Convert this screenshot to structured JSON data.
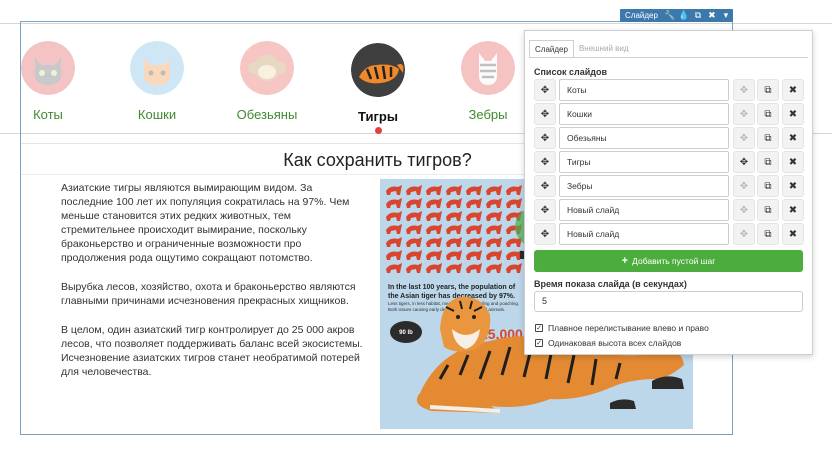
{
  "toolbar": {
    "label": "Слайдер",
    "icons": [
      "wrench-icon",
      "drop-icon",
      "copy-icon",
      "close-icon",
      "chevron-down-icon"
    ],
    "glyphs": [
      "🔧",
      "💧",
      "⧉",
      "✖",
      "▾"
    ]
  },
  "slider_tabs": [
    {
      "label": "Коты",
      "icon": "cat-icon",
      "active": false
    },
    {
      "label": "Кошки",
      "icon": "kitten-icon",
      "active": false
    },
    {
      "label": "Обезьяны",
      "icon": "monkey-icon",
      "active": false
    },
    {
      "label": "Тигры",
      "icon": "tiger-icon",
      "active": true
    },
    {
      "label": "Зебры",
      "icon": "zebra-icon",
      "active": false
    }
  ],
  "content": {
    "title": "Как сохранить тигров?",
    "paragraphs": [
      "Азиатские тигры являются вымирающим видом. За последние 100 лет их популяция сократилась на 97%. Чем меньше становится этих редких животных, тем стремительнее происходит вымирание, поскольку браконьерство и ограниченные возможности про продолжения рода ощутимо сокращают потомство.",
      "Вырубка лесов, хозяйство, охота и браконьерство являются главными причинами исчезновения прекрасных хищников.",
      "В целом, один азиатский тигр контролирует до 25 000 акров лесов, что позволяет поддерживать баланс всей экосистемы. Исчезновение азиатских тигров станет необратимой потерей для человечества."
    ],
    "infographic": {
      "headline": "In the last 100 years, the population of the Asian tiger has decreased by 97%.",
      "subtext": "Less tigers, in less habitat, means more inbreeding and poaching. Both issues causing early death to these beautiful animals.",
      "big_number": "25,000 a",
      "badge": "90 lb",
      "colors": {
        "background": "#bcd6ea",
        "tiger_icon": "#d9452e",
        "dark": "#2b2b2b",
        "green": "#4caf50"
      }
    }
  },
  "panel": {
    "tabs": [
      {
        "label": "Слайдер",
        "active": true
      },
      {
        "label": "Внешний вид",
        "active": false
      }
    ],
    "list_title": "Список слайдов",
    "slides": [
      "Коты",
      "Кошки",
      "Обезьяны",
      "Тигры",
      "Зебры",
      "Новый слайд",
      "Новый слайд"
    ],
    "add_button_label": "Добавить пустой шаг",
    "add_button_glyph": "+",
    "time_label": "Время показа слайда (в секундах)",
    "time_value": "5",
    "checkboxes": [
      {
        "label": "Плавное перелистывание влево и право",
        "checked": true
      },
      {
        "label": "Одинаковая высота всех слайдов",
        "checked": true
      }
    ],
    "row_icons": {
      "move": "move-icon",
      "settings": "settings-icon",
      "copy": "copy-icon",
      "delete": "delete-icon"
    }
  }
}
